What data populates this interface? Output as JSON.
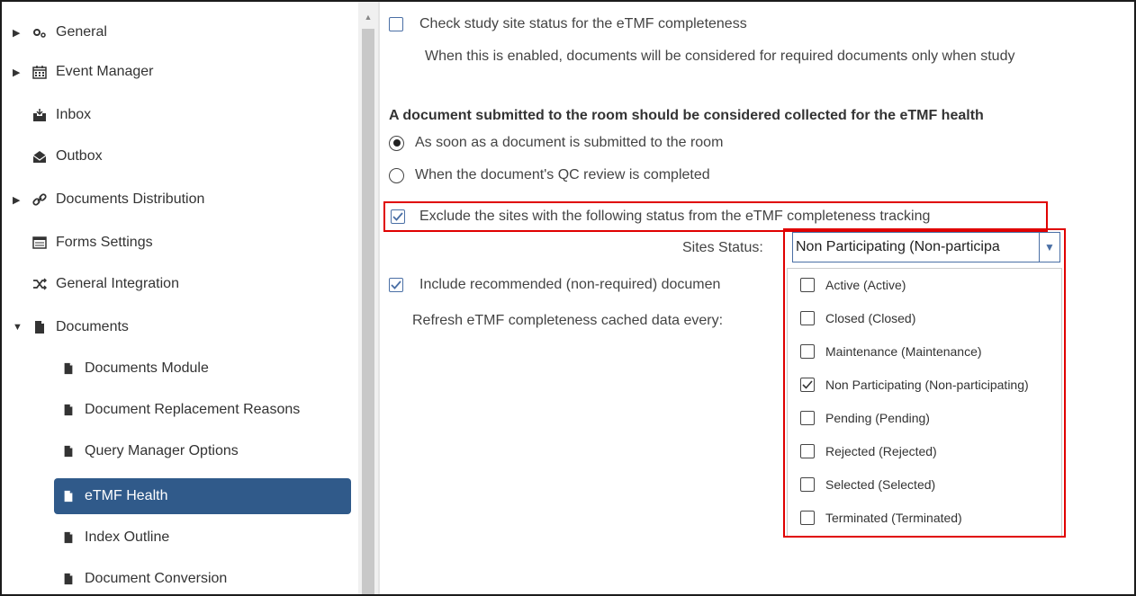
{
  "sidebar": {
    "items": [
      {
        "label": "General",
        "icon": "gears-icon",
        "expandable": true
      },
      {
        "label": "Event Manager",
        "icon": "calendar-icon",
        "expandable": true
      },
      {
        "label": "Inbox",
        "icon": "inbox-icon",
        "expandable": false
      },
      {
        "label": "Outbox",
        "icon": "outbox-icon",
        "expandable": false
      },
      {
        "label": "Documents Distribution",
        "icon": "link-icon",
        "expandable": true
      },
      {
        "label": "Forms Settings",
        "icon": "form-icon",
        "expandable": false
      },
      {
        "label": "General Integration",
        "icon": "shuffle-icon",
        "expandable": false
      },
      {
        "label": "Documents",
        "icon": "document-icon",
        "expanded": true
      },
      {
        "label": "Documents Module",
        "icon": "document-icon"
      },
      {
        "label": "Document Replacement Reasons",
        "icon": "document-icon"
      },
      {
        "label": "Query Manager Options",
        "icon": "document-icon"
      },
      {
        "label": "eTMF Health",
        "icon": "document-icon",
        "active": true
      },
      {
        "label": "Index Outline",
        "icon": "document-icon"
      },
      {
        "label": "Document Conversion",
        "icon": "document-icon"
      }
    ],
    "active_color": "#305a8a"
  },
  "main": {
    "check_site_status": {
      "label": "Check study site status for the eTMF completeness",
      "checked": false
    },
    "check_site_status_desc": "When this is enabled, documents will be considered for required documents only when study",
    "collected_heading": "A document submitted to the room should be considered collected for the eTMF health",
    "radio_submitted": {
      "label": "As soon as a document is submitted to the room",
      "selected": true
    },
    "radio_qc": {
      "label": "When the document's QC review is completed",
      "selected": false
    },
    "exclude_sites": {
      "label": "Exclude the sites with the following status from the eTMF completeness tracking",
      "checked": true
    },
    "sites_status_label": "Sites Status:",
    "sites_status_value": "Non Participating (Non-participa",
    "include_recommended": {
      "label": "Include recommended (non-required) documen",
      "checked": true
    },
    "refresh_label": "Refresh eTMF completeness cached data every:"
  },
  "dropdown": {
    "options": [
      {
        "label": "Active (Active)",
        "checked": false
      },
      {
        "label": "Closed (Closed)",
        "checked": false
      },
      {
        "label": "Maintenance (Maintenance)",
        "checked": false
      },
      {
        "label": "Non Participating (Non-participating)",
        "checked": true
      },
      {
        "label": "Pending (Pending)",
        "checked": false
      },
      {
        "label": "Rejected (Rejected)",
        "checked": false
      },
      {
        "label": "Selected (Selected)",
        "checked": false
      },
      {
        "label": "Terminated (Terminated)",
        "checked": false
      }
    ]
  },
  "colors": {
    "highlight": "#e00000",
    "checkbox": "#4a6fa5"
  }
}
